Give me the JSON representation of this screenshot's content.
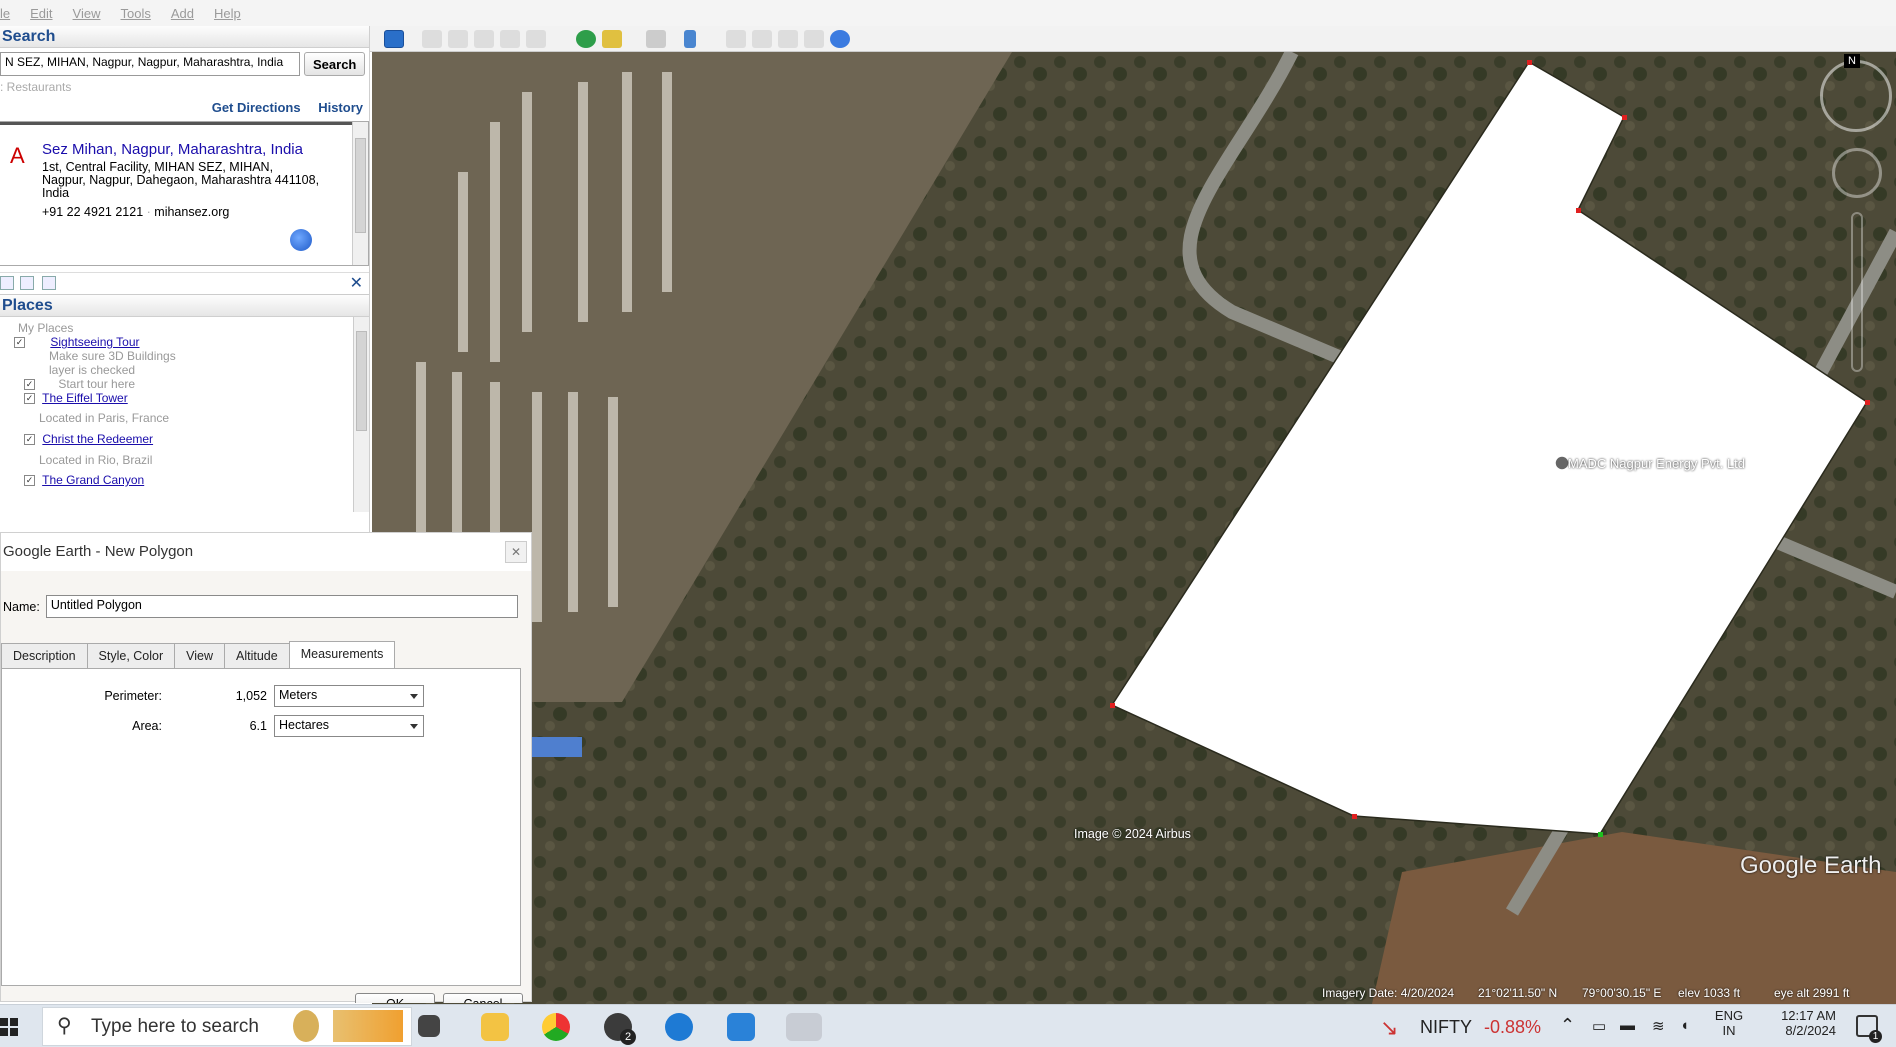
{
  "menu": [
    "le",
    "Edit",
    "View",
    "Tools",
    "Add",
    "Help"
  ],
  "search_panel": {
    "title": "Search",
    "query": "N SEZ, MIHAN, Nagpur, Nagpur, Maharashtra, India",
    "search_button": "Search",
    "hint": ": Restaurants",
    "get_directions": "Get Directions",
    "history": "History",
    "result": {
      "letter": "A",
      "title": "Sez Mihan, Nagpur, Maharashtra, India",
      "address_line1": "1st, Central Facility, MIHAN SEZ, MIHAN,",
      "address_line2": "Nagpur, Nagpur, Dahegaon, Maharashtra 441108,",
      "address_line3": "India",
      "phone": "+91 22 4921 2121",
      "website": "mihansez.org"
    }
  },
  "places": {
    "title": "Places",
    "my_places": "My Places",
    "tour": "Sightseeing Tour",
    "tour_note1": "Make sure 3D Buildings",
    "tour_note2": "layer is checked",
    "start_tour": "Start tour here",
    "item1": "The Eiffel Tower",
    "item1_note": "Located in Paris, France",
    "item2": "Christ the Redeemer",
    "item2_note": "Located in Rio, Brazil",
    "item3": "The Grand Canyon"
  },
  "dialog": {
    "title": "Google Earth - New Polygon",
    "name_label": "Name:",
    "name_value": "Untitled Polygon",
    "tabs": [
      "Description",
      "Style, Color",
      "View",
      "Altitude",
      "Measurements"
    ],
    "perimeter_label": "Perimeter:",
    "perimeter_value": "1,052",
    "perimeter_unit": "Meters",
    "area_label": "Area:",
    "area_value": "6.1",
    "area_unit": "Hectares",
    "ok": "OK",
    "cancel": "Cancel"
  },
  "map": {
    "placemark": "MADC Nagpur Energy Pvt. Ltd",
    "copyright": "Image © 2024 Airbus",
    "brand": "Google Earth",
    "imagery_date": "Imagery Date: 4/20/2024",
    "lat": "21°02'11.50\" N",
    "lon": "79°00'30.15\" E",
    "elev": "elev 1033 ft",
    "eye_alt": "eye alt 2991 ft",
    "north": "N"
  },
  "taskbar": {
    "search_placeholder": "Type here to search",
    "nifty_label": "NIFTY",
    "nifty_change": "-0.88%",
    "lang1": "ENG",
    "lang2": "IN",
    "time": "12:17 AM",
    "date": "8/2/2024",
    "notif_count": "1",
    "whatsapp_badge": "2"
  }
}
